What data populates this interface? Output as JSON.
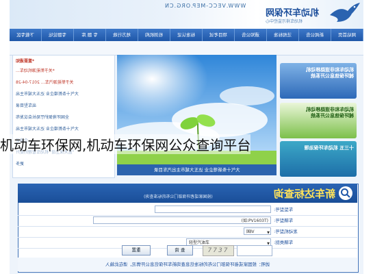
{
  "overlay_title": "机动车环保网,机动车环保网公众查询平台",
  "header": {
    "url": "WWW.VECC-MEP.ORG.CN",
    "logo_text": "机动车环保网",
    "subtitle": "机动车排污监控中心"
  },
  "nav": {
    "items": [
      "网站首页",
      "新闻公告",
      "法规标准",
      "通知公告",
      "项目考试",
      "标准认证",
      "检测机构",
      "地方行政",
      "专 题 库",
      "专题论坛",
      "下载专区"
    ]
  },
  "news": {
    "heading": "*重要通知",
    "items": [
      {
        "text": "*关于新能源机动车...",
        "red": true
      },
      {
        "text": "关于新能源汽车...   2017-04-28",
        "red": true
      },
      {
        "text": "大气十条新增企业 达五大城市主出",
        "red": false
      },
      {
        "text": "出车型目录",
        "red": false
      },
      {
        "text": "全国环境保护厅局长会议发布",
        "red": false
      },
      {
        "text": "大气十条新增企业 达五大城市主出",
        "red": false
      },
      {
        "text": "合格证",
        "red": false
      },
      {
        "text": "\"蓝天保卫战\" 机动车管理的提升",
        "red": false
      },
      {
        "text": "更多",
        "red": false
      }
    ]
  },
  "photo_caption": "大气十条新增企业 达五大城市主出汽车目录",
  "ads": [
    {
      "text": "机动车和非道路移动机械环保信息公开系统",
      "theme": "blue"
    },
    {
      "text": "机动车和非道路移动机械环保信息公开系统",
      "theme": "green"
    },
    {
      "text": "十三五 机动车环保治理",
      "theme": "teal"
    }
  ],
  "query": {
    "title": "新车达标查询",
    "note": "(按国家或者环保部门公布的标准查询)",
    "fields": [
      {
        "label": "车型型号:",
        "value": "",
        "placeholder": ""
      },
      {
        "label": "车辆型号:",
        "value": "(如:PV1603T)",
        "placeholder": ""
      },
      {
        "label": "发动机型号:",
        "value": "国Ⅳ",
        "placeholder": ""
      },
      {
        "label": "车辆类别:",
        "value": "轻型汽油车",
        "placeholder": ""
      }
    ],
    "reset_label": "重置",
    "query_label": "查 询",
    "captcha_label": "验证码",
    "captcha_text": "7737",
    "bottom_note": "说明：按国家或者环保部门公布的标准信息查询新车环保信息公开情况，请在此输入"
  },
  "colors": {
    "nav": "#1f57a8",
    "accent": "#2c63ae",
    "title_yellow": "#ffe35a",
    "alert_red": "#c0392b"
  }
}
